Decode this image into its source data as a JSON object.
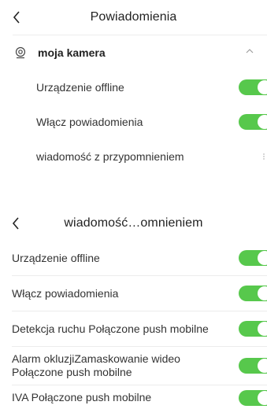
{
  "colors": {
    "toggle_on": "#57c84c",
    "divider": "#ececec"
  },
  "top_screen": {
    "title": "Powiadomienia",
    "back_icon": "chevron-left-icon",
    "camera": {
      "name": "moja kamera",
      "icon": "camera-icon",
      "expand_icon": "chevron-up-icon"
    },
    "items": [
      {
        "label": "Urządzenie offline",
        "enabled": true
      },
      {
        "label": "Włącz powiadomienia",
        "enabled": true
      },
      {
        "label": "wiadomość z przypomnieniem"
      }
    ]
  },
  "bottom_screen": {
    "title": "wiadomość…omnieniem",
    "back_icon": "chevron-left-icon",
    "items": [
      {
        "label": "Urządzenie offline",
        "enabled": true
      },
      {
        "label": "Włącz powiadomienia",
        "enabled": true
      },
      {
        "label": "Detekcja ruchu Połączone push mobilne",
        "enabled": true
      },
      {
        "label": "Alarm okluzjiZamaskowanie wideo Połączone push mobilne",
        "enabled": true
      },
      {
        "label": "IVA Połączone push mobilne",
        "enabled": true
      }
    ]
  }
}
